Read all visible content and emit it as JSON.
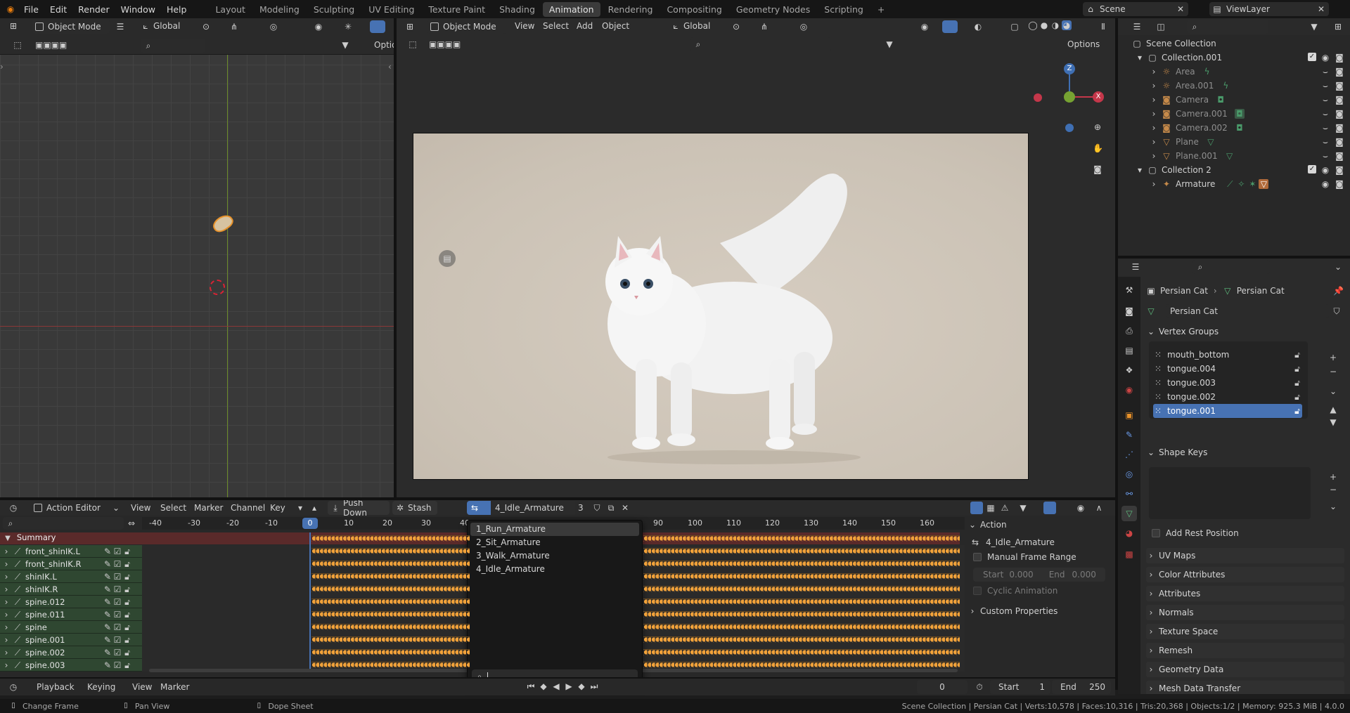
{
  "topbar": {
    "menus": [
      "File",
      "Edit",
      "Render",
      "Window",
      "Help"
    ],
    "workspaces": [
      "Layout",
      "Modeling",
      "Sculpting",
      "UV Editing",
      "Texture Paint",
      "Shading",
      "Animation",
      "Rendering",
      "Compositing",
      "Geometry Nodes",
      "Scripting",
      "+"
    ],
    "active_workspace": "Animation",
    "scene_label": "Scene",
    "viewlayer_label": "ViewLayer"
  },
  "left_viewport": {
    "mode_label": "Object Mode",
    "orientation_label": "Global",
    "options_label": "Optio"
  },
  "main_viewport": {
    "mode_label": "Object Mode",
    "menus": [
      "View",
      "Select",
      "Add",
      "Object"
    ],
    "orientation_label": "Global",
    "options_label": "Options",
    "gizmo": {
      "z": "Z",
      "y": "Y",
      "x": "X"
    }
  },
  "outliner": {
    "root": "Scene Collection",
    "collections": [
      {
        "name": "Collection.001",
        "children": [
          "Area",
          "Area.001",
          "Camera",
          "Camera.001",
          "Camera.002",
          "Plane",
          "Plane.001"
        ]
      },
      {
        "name": "Collection 2",
        "children": [
          "Armature"
        ]
      }
    ]
  },
  "properties": {
    "breadcrumb_object": "Persian Cat",
    "breadcrumb_data": "Persian Cat",
    "mesh_name": "Persian Cat",
    "sections": {
      "vertex_groups": "Vertex Groups",
      "shape_keys": "Shape Keys",
      "add_rest_position": "Add Rest Position"
    },
    "vertex_groups": [
      "mouth_bottom",
      "tongue.004",
      "tongue.003",
      "tongue.002",
      "tongue.001"
    ],
    "selected_vertex_group": "tongue.001",
    "collapsed_panels": [
      "UV Maps",
      "Color Attributes",
      "Attributes",
      "Normals",
      "Texture Space",
      "Remesh",
      "Geometry Data",
      "Mesh Data Transfer"
    ]
  },
  "action_editor": {
    "editor_label": "Action Editor",
    "menus": [
      "View",
      "Select",
      "Marker",
      "Channel",
      "Key"
    ],
    "push_down": "Push Down",
    "stash": "Stash",
    "action_name": "4_Idle_Armature",
    "users": "3",
    "ruler": [
      "-40",
      "-30",
      "-20",
      "-10",
      "0",
      "10",
      "20",
      "30",
      "40",
      "90",
      "100",
      "110",
      "120",
      "130",
      "140",
      "150",
      "160"
    ],
    "current_frame_marker": "0",
    "summary": "Summary",
    "channels": [
      "front_shinIK.L",
      "front_shinIK.R",
      "shinIK.L",
      "shinIK.R",
      "spine.012",
      "spine.011",
      "spine",
      "spine.001",
      "spine.002",
      "spine.003"
    ],
    "dropdown_items": [
      "1_Run_Armature",
      "2_Sit_Armature",
      "3_Walk_Armature",
      "4_Idle_Armature"
    ],
    "highlighted_item": "1_Run_Armature",
    "side_panel": {
      "header": "Action",
      "action": "4_Idle_Armature",
      "manual_frame_range": "Manual Frame Range",
      "start_label": "Start",
      "start_value": "0.000",
      "end_label": "End",
      "end_value": "0.000",
      "cyclic": "Cyclic Animation",
      "custom_properties": "Custom Properties"
    }
  },
  "timeline": {
    "menus": [
      "Playback",
      "Keying",
      "View",
      "Marker"
    ],
    "current_frame": "0",
    "start_label": "Start",
    "start_value": "1",
    "end_label": "End",
    "end_value": "250"
  },
  "statusbar": {
    "left": [
      "Change Frame",
      "Pan View",
      "Dope Sheet"
    ],
    "right": "Scene Collection | Persian Cat | Verts:10,578 | Faces:10,316 | Tris:20,368 | Objects:1/2 | Memory: 925.3 MiB | 4.0.0"
  },
  "colors": {
    "accent": "#4772b3",
    "key_orange": "#f0a13a",
    "channel_green": "#2f4731",
    "background": "#1d1d1d"
  }
}
